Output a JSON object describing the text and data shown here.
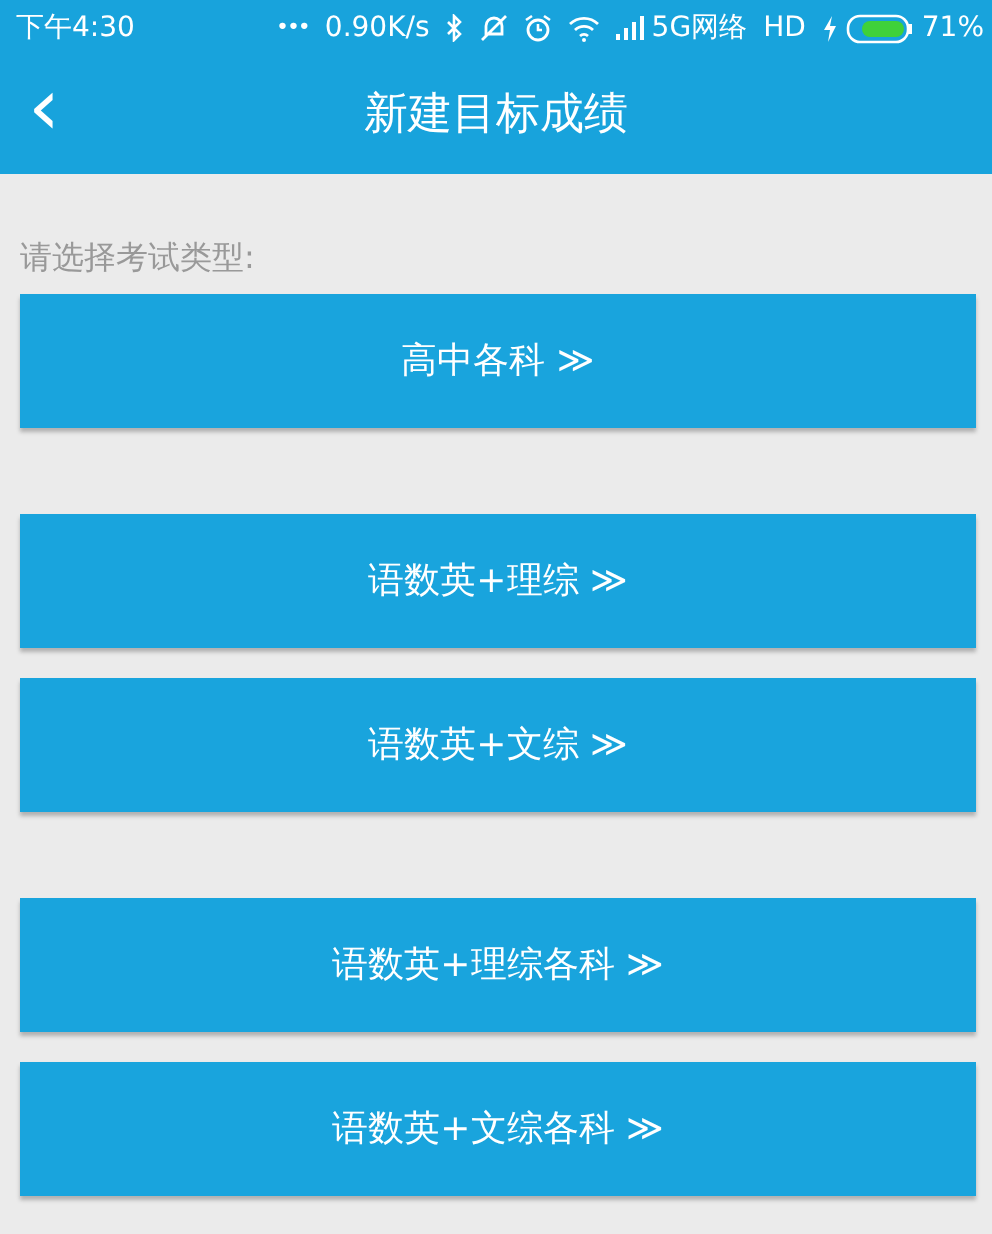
{
  "status_bar": {
    "time": "下午4:30",
    "dots": "•••",
    "speed": "0.90K/s",
    "network": "5G网络",
    "hd": "HD",
    "battery": "71%"
  },
  "header": {
    "back": "‹",
    "title": "新建目标成绩"
  },
  "prompt": "请选择考试类型:",
  "groups": [
    {
      "buttons": [
        {
          "label": "高中各科 ≫"
        }
      ]
    },
    {
      "buttons": [
        {
          "label": "语数英+理综 ≫"
        },
        {
          "label": "语数英+文综 ≫"
        }
      ]
    },
    {
      "buttons": [
        {
          "label": "语数英+理综各科 ≫"
        },
        {
          "label": "语数英+文综各科 ≫"
        }
      ]
    }
  ]
}
